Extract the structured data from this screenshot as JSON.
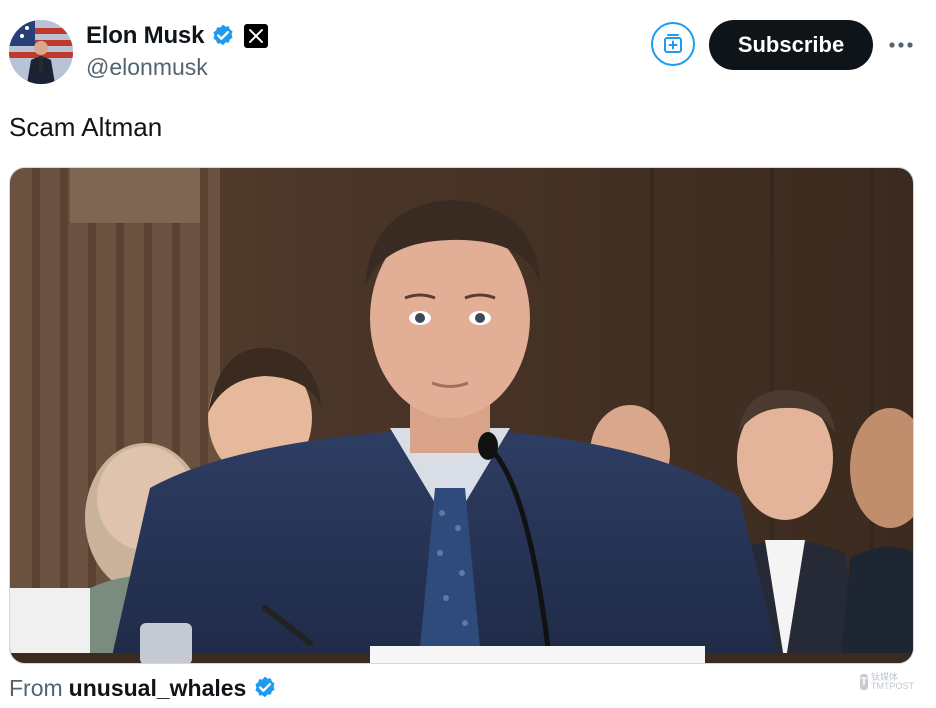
{
  "author": {
    "display_name": "Elon Musk",
    "handle": "@elonmusk",
    "verified_icon": "verified-badge-icon",
    "affiliate_icon": "x-logo-icon"
  },
  "header_actions": {
    "add_to_list_icon": "add-to-list-icon",
    "subscribe_label": "Subscribe",
    "more_icon": "more-icon"
  },
  "tweet": {
    "text": "Scam Altman",
    "media_icon": "photo"
  },
  "source": {
    "prefix": "From",
    "name": "unusual_whales",
    "verified_icon": "verified-badge-icon"
  },
  "watermark": {
    "logo_letter": "T",
    "text": "钛媒体",
    "subtext": "TMTPOST"
  },
  "colors": {
    "accent": "#1d9bf0",
    "text": "#0f1419",
    "secondary": "#536471",
    "button_bg": "#0f1419"
  }
}
